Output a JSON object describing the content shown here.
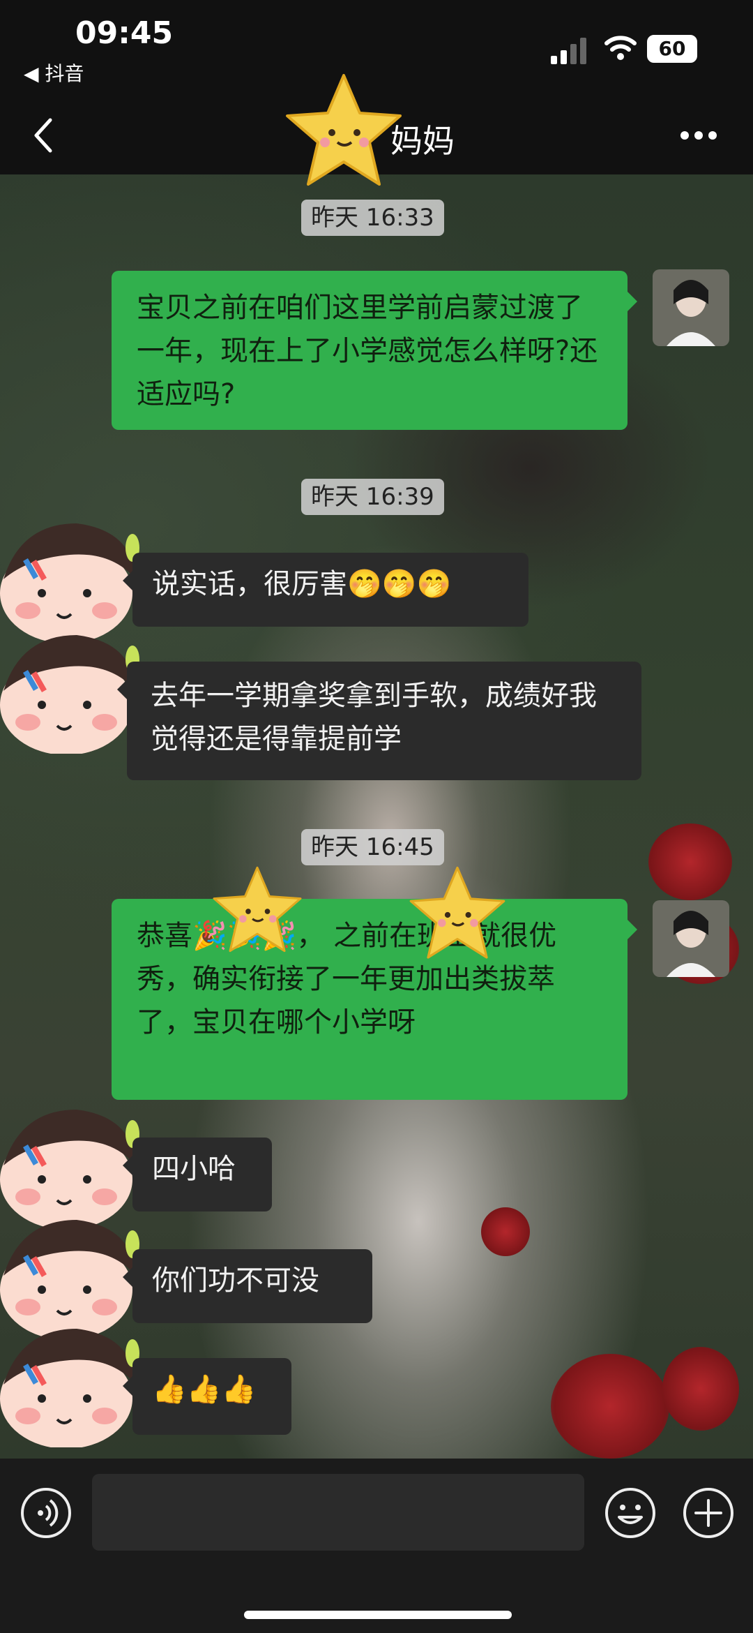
{
  "status_bar": {
    "time": "09:45",
    "back_app": "◀ 抖音",
    "battery": "60"
  },
  "header": {
    "title": "妈妈",
    "back_icon": "chevron-left-icon",
    "more_icon": "more-dots-icon"
  },
  "messages": [
    {
      "type": "time",
      "text": "昨天 16:33"
    },
    {
      "type": "out",
      "text": "宝贝之前在咱们这里学前启蒙过渡了一年，现在上了小学感觉怎么样呀?还适应吗?"
    },
    {
      "type": "time",
      "text": "昨天 16:39"
    },
    {
      "type": "in",
      "text": "说实话，很厉害",
      "emoji": "🤭🤭🤭"
    },
    {
      "type": "in",
      "text": "去年一学期拿奖拿到手软，成绩好我觉得还是得靠提前学"
    },
    {
      "type": "time",
      "text": "昨天 16:45"
    },
    {
      "type": "out",
      "text": "恭喜",
      "emoji": "🎉🎉🎉",
      "text_cont": "，    之前在班上就很优秀，确实衔接了一年更加出类拔萃了，宝贝在哪个小学呀"
    },
    {
      "type": "in",
      "text": "四小哈"
    },
    {
      "type": "in",
      "text": "你们功不可没"
    },
    {
      "type": "in",
      "text": "",
      "emoji": "👍👍👍"
    }
  ],
  "input_bar": {
    "voice_icon": "voice-icon",
    "emoji_icon": "smiley-icon",
    "plus_icon": "plus-icon"
  },
  "colors": {
    "outgoing_bubble": "#31b04d",
    "incoming_bubble": "#2b2b2b",
    "time_chip": "#d2d2d2"
  }
}
